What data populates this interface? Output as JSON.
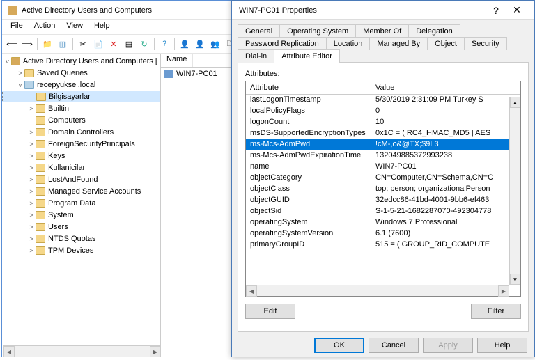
{
  "mainWindow": {
    "title": "Active Directory Users and Computers",
    "menu": [
      "File",
      "Action",
      "View",
      "Help"
    ]
  },
  "tree": {
    "root": "Active Directory Users and Computers [",
    "items": [
      {
        "label": "Saved Queries",
        "depth": 1,
        "exp": ">"
      },
      {
        "label": "recepyuksel.local",
        "depth": 1,
        "exp": "v",
        "srv": true
      },
      {
        "label": "Bilgisayarlar",
        "depth": 2,
        "exp": "",
        "sel": true
      },
      {
        "label": "Builtin",
        "depth": 2,
        "exp": ">"
      },
      {
        "label": "Computers",
        "depth": 2,
        "exp": ""
      },
      {
        "label": "Domain Controllers",
        "depth": 2,
        "exp": ">"
      },
      {
        "label": "ForeignSecurityPrincipals",
        "depth": 2,
        "exp": ">"
      },
      {
        "label": "Keys",
        "depth": 2,
        "exp": ">"
      },
      {
        "label": "Kullanicilar",
        "depth": 2,
        "exp": ">"
      },
      {
        "label": "LostAndFound",
        "depth": 2,
        "exp": ">"
      },
      {
        "label": "Managed Service Accounts",
        "depth": 2,
        "exp": ">"
      },
      {
        "label": "Program Data",
        "depth": 2,
        "exp": ">"
      },
      {
        "label": "System",
        "depth": 2,
        "exp": ">"
      },
      {
        "label": "Users",
        "depth": 2,
        "exp": ">"
      },
      {
        "label": "NTDS Quotas",
        "depth": 2,
        "exp": ">"
      },
      {
        "label": "TPM Devices",
        "depth": 2,
        "exp": ">"
      }
    ]
  },
  "list": {
    "header": "Name",
    "item": "WIN7-PC01"
  },
  "dialog": {
    "title": "WIN7-PC01 Properties",
    "tabsRow1": [
      "General",
      "Operating System",
      "Member Of",
      "Delegation",
      "Password Replication"
    ],
    "tabsRow2": [
      "Location",
      "Managed By",
      "Object",
      "Security",
      "Dial-in",
      "Attribute Editor"
    ],
    "activeTab": "Attribute Editor",
    "attrLabel": "Attributes:",
    "headA": "Attribute",
    "headV": "Value",
    "rows": [
      {
        "a": "lastLogonTimestamp",
        "v": "5/30/2019 2:31:09 PM Turkey S"
      },
      {
        "a": "localPolicyFlags",
        "v": "0"
      },
      {
        "a": "logonCount",
        "v": "10"
      },
      {
        "a": "msDS-SupportedEncryptionTypes",
        "v": "0x1C = ( RC4_HMAC_MD5 | AES"
      },
      {
        "a": "ms-Mcs-AdmPwd",
        "v": "!cM-,o&@TX;$9L3",
        "sel": true
      },
      {
        "a": "ms-Mcs-AdmPwdExpirationTime",
        "v": "132049885372993238"
      },
      {
        "a": "name",
        "v": "WIN7-PC01"
      },
      {
        "a": "objectCategory",
        "v": "CN=Computer,CN=Schema,CN=C"
      },
      {
        "a": "objectClass",
        "v": "top; person; organizationalPerson"
      },
      {
        "a": "objectGUID",
        "v": "32edcc86-41bd-4001-9bb6-ef463"
      },
      {
        "a": "objectSid",
        "v": "S-1-5-21-1682287070-492304778"
      },
      {
        "a": "operatingSystem",
        "v": "Windows 7 Professional"
      },
      {
        "a": "operatingSystemVersion",
        "v": "6.1 (7600)"
      },
      {
        "a": "primaryGroupID",
        "v": "515 = ( GROUP_RID_COMPUTE"
      }
    ],
    "btnEdit": "Edit",
    "btnFilter": "Filter",
    "btnOK": "OK",
    "btnCancel": "Cancel",
    "btnApply": "Apply",
    "btnHelp": "Help"
  }
}
